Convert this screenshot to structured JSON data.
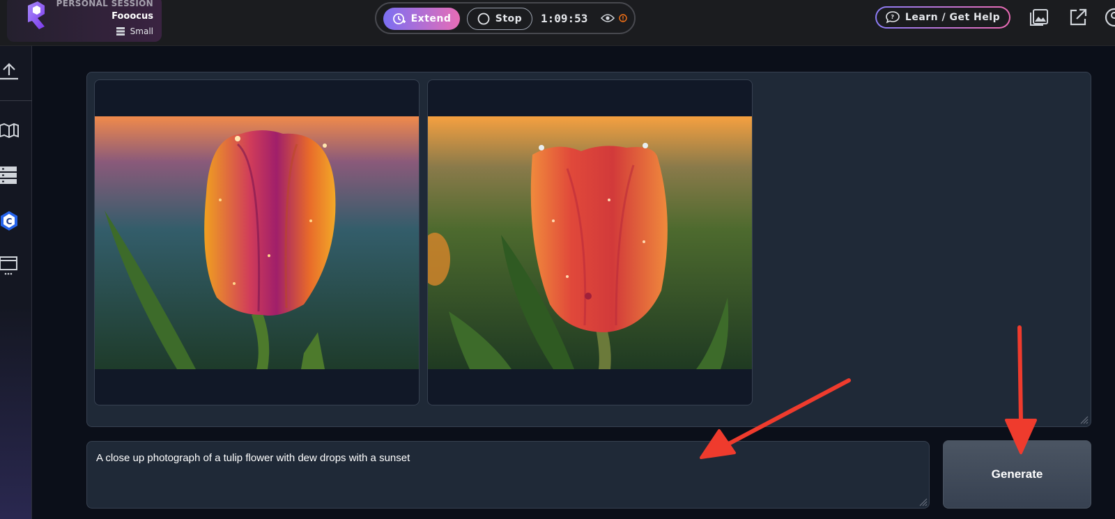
{
  "session": {
    "label": "PERSONAL SESSION",
    "name": "Fooocus",
    "size": "Small"
  },
  "controls": {
    "extend_label": "Extend",
    "stop_label": "Stop",
    "timer": "1:09:53"
  },
  "header": {
    "help_label": "Learn / Get Help"
  },
  "sidebar": {
    "icons": [
      "upload-icon",
      "book-icon",
      "server-icon",
      "c-badge-icon",
      "monitor-icon"
    ]
  },
  "gallery": {
    "images": [
      "tulip-image-1",
      "tulip-image-2"
    ]
  },
  "prompt": {
    "value": "A close up photograph of a tulip flower with dew drops with a sunset"
  },
  "generate": {
    "label": "Generate"
  },
  "colors": {
    "accent_gradient_start": "#7b6ff2",
    "accent_gradient_end": "#e76db6",
    "annotation_arrow": "#ef3b2d",
    "panel": "#1f2937"
  }
}
